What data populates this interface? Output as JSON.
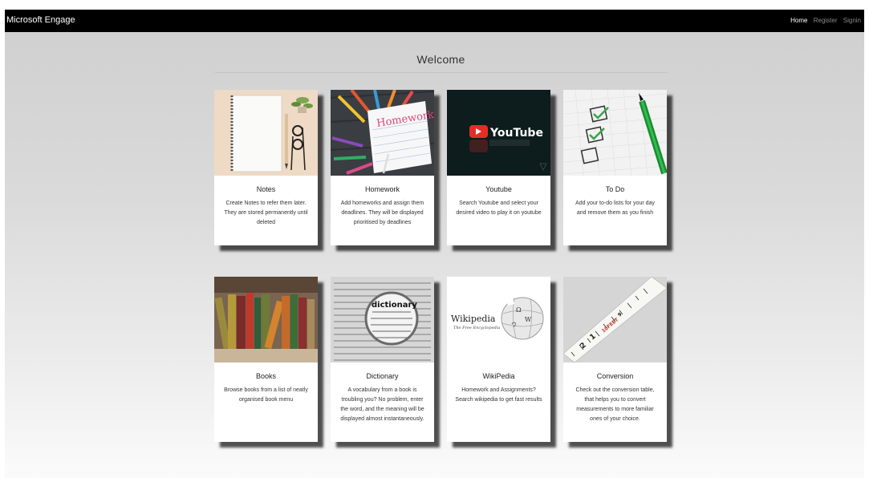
{
  "navbar": {
    "brand": "Microsoft Engage",
    "links": [
      "Home",
      "Register",
      "Signin"
    ],
    "active_link": "Home"
  },
  "heading": "Welcome",
  "images": {
    "wikipedia_wordmark": "Wikipedia",
    "wikipedia_tagline": "The Free Encyclopedia",
    "dictionary_word": "dictionary",
    "homework_word": "Homework",
    "youtube_word": "YouTube",
    "tape_marks": [
      "2",
      "1",
      "10FEET",
      "9"
    ]
  },
  "cards": [
    {
      "title": "Notes",
      "description": "Create Notes to refer them later. They are stored permanently until deleted",
      "image": "notebook-image"
    },
    {
      "title": "Homework",
      "description": "Add homeworks and assign them deadlines. They will be displayed prioritised by deadlines",
      "image": "homework-image"
    },
    {
      "title": "Youtube",
      "description": "Search Youtube and select your desired video to play it on youtube",
      "image": "youtube-image"
    },
    {
      "title": "To Do",
      "description": "Add your to-do lists for your day and remove them as you finish",
      "image": "checklist-image"
    },
    {
      "title": "Books",
      "description": "Browse books from a list of neatly organised book menu",
      "image": "books-image"
    },
    {
      "title": "Dictionary",
      "description": "A vocabulary from a book is troubling you? No problem, enter the word, and the meaning will be displayed almost instantaneously.",
      "image": "dictionary-image"
    },
    {
      "title": "WikiPedia",
      "description": "Homework and Assignments? Search wikipedia to get fast results",
      "image": "wikipedia-image"
    },
    {
      "title": "Conversion",
      "description": "Check out the conversion table, that helps you to convert measurements to more familiar ones of your choice.",
      "image": "measuring-tape-image"
    }
  ]
}
